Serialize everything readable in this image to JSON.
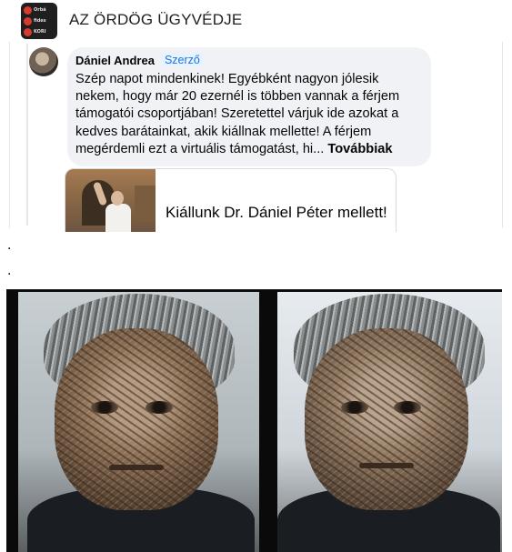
{
  "header": {
    "page_title": "AZ ÖRDÖG ÜGYVÉDJE",
    "thumbnail_lines": [
      "Orbá",
      "fides",
      "KORI"
    ]
  },
  "comment": {
    "author": "Dániel Andrea",
    "author_badge": "Szerző",
    "text": "Szép napot mindenkinek! Egyébként nagyon jólesik nekem, hogy már 20 ezernél is többen vannak a férjem támogatói csoportjában! Szeretettel várjuk ide azokat a kedves barátainkat, akik kiállnak mellette! A férjem megérdemli ezt a virtuális támogatást, hi...",
    "see_more": "Továbbiak",
    "link_preview": {
      "title": "Kiállunk Dr. Dániel Péter mellett!"
    }
  },
  "separators": [
    ".",
    "."
  ],
  "photo": {
    "icon": "edited-portrait-image"
  },
  "colors": {
    "badge_text": "#1b74e4",
    "badge_bg": "#e7f3ff",
    "bubble_bg": "#f0f2f5"
  }
}
